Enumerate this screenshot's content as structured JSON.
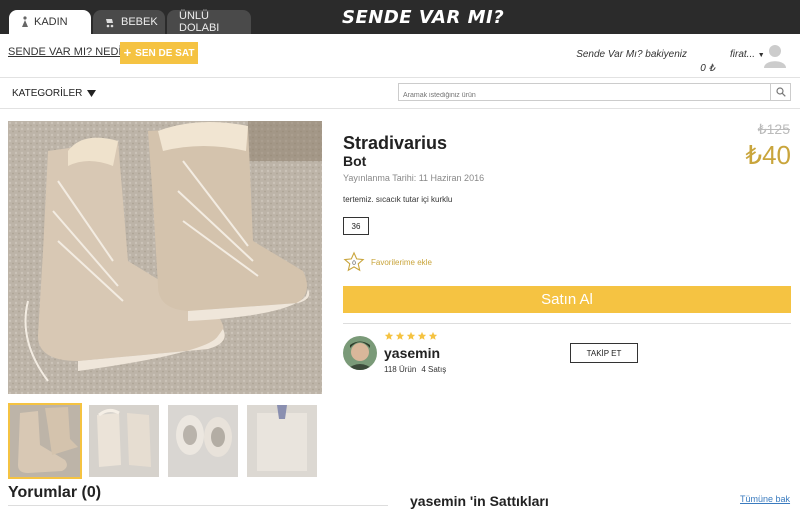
{
  "header": {
    "tabs": [
      {
        "label": "KADIN",
        "icon": "woman-icon"
      },
      {
        "label": "BEBEK",
        "icon": "stroller-icon"
      },
      {
        "label": "ÜNLÜ DOLABI",
        "icon": ""
      }
    ],
    "logo": "SENDE VAR MI?"
  },
  "subheader": {
    "whatis_link": "SENDE VAR MI? NEDİR?",
    "sell_button": "SEN DE SAT",
    "balance_label": "Sende Var Mı? bakiyeniz",
    "balance_value": "0 ₺",
    "user_name": "firat..."
  },
  "navbar": {
    "categories_label": "KATEGORİLER",
    "search_placeholder": "Aramak istediğiniz ürün"
  },
  "product": {
    "brand": "Stradivarius",
    "type": "Bot",
    "published": "Yayınlanma Tarihi: 11 Haziran 2016",
    "description": "tertemiz. sıcacık tutar içi kurklu",
    "size": "36",
    "favorite_count": "0",
    "favorite_label": "Favorilerime ekle",
    "old_price": "₺125",
    "price": "₺40",
    "buy_label": "Satın Al"
  },
  "seller": {
    "name": "yasemin",
    "rating": 5,
    "products": "118 Ürün",
    "sales": "4 Satış",
    "follow_label": "TAKİP ET"
  },
  "footer": {
    "comments_title": "Yorumlar (0)",
    "sold_title": "yasemin 'in Sattıkları",
    "see_all": "Tümüne bak"
  },
  "colors": {
    "accent": "#f5c342",
    "price": "#c9a53c",
    "topbar": "#2b2b2b",
    "link": "#3a7bbf"
  }
}
